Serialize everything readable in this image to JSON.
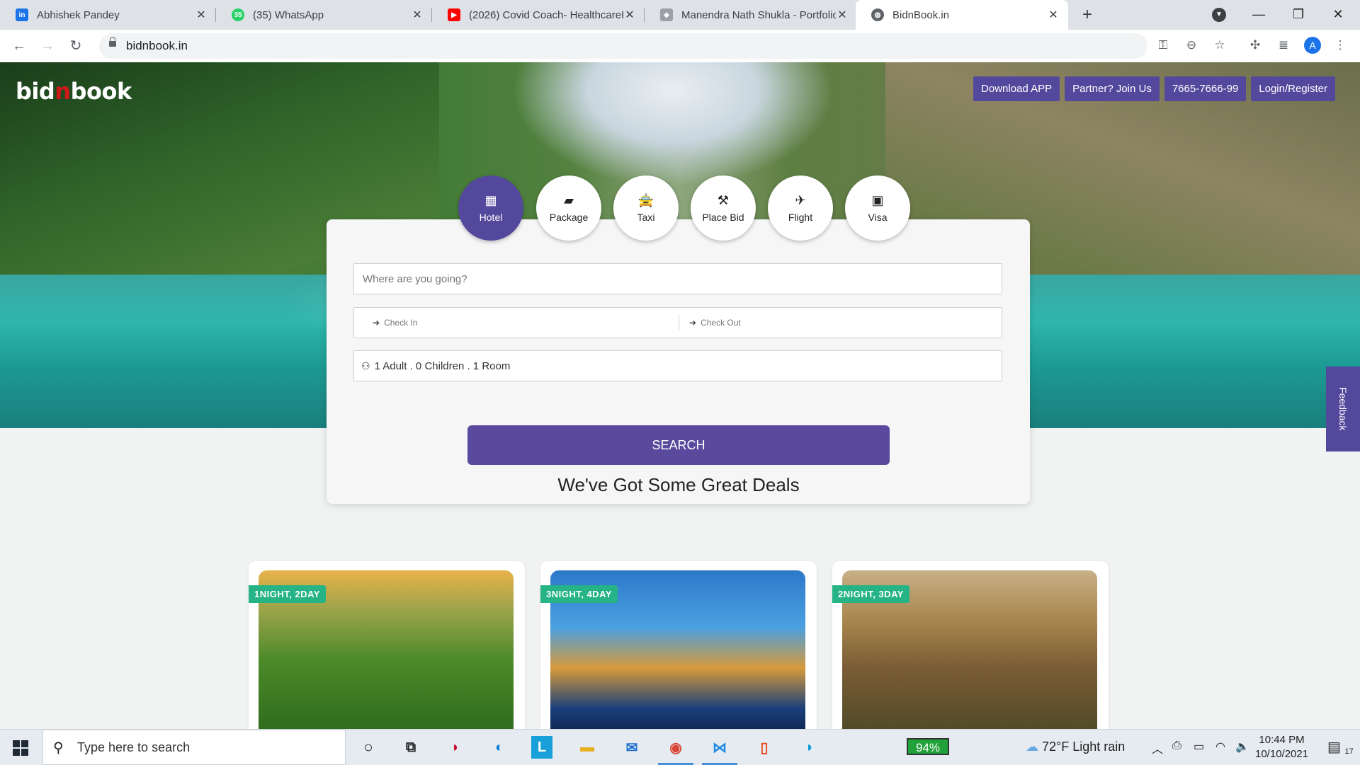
{
  "browser": {
    "tabs": [
      {
        "title": "Abhishek Pandey",
        "icon": "linkedin-style-icon",
        "color": "#1a73e8"
      },
      {
        "title": "(35) WhatsApp",
        "icon": "whatsapp-icon",
        "color": "#25d366",
        "badge": "35"
      },
      {
        "title": "(2026) Covid Coach- HealthcareP",
        "icon": "youtube-icon",
        "color": "#ff0000"
      },
      {
        "title": "Manendra Nath Shukla - Portfolic",
        "icon": "portfolio-icon",
        "color": "#5f6368"
      },
      {
        "title": "BidnBook.in",
        "icon": "globe-icon",
        "color": "#5f6368"
      }
    ],
    "url": "bidnbook.in",
    "profile_initial": "A"
  },
  "site": {
    "logo_prefix": "bid",
    "logo_n": "n",
    "logo_suffix": "book",
    "top_buttons": [
      "Download APP",
      "Partner? Join Us",
      "7665-7666-99",
      "Login/Register"
    ],
    "feedback_label": "Feedback",
    "services": [
      {
        "label": "Hotel",
        "icon": "hotel-icon",
        "glyph": "▦",
        "active": true
      },
      {
        "label": "Package",
        "icon": "package-icon",
        "glyph": "▰",
        "active": false
      },
      {
        "label": "Taxi",
        "icon": "taxi-icon",
        "glyph": "🚖",
        "active": false
      },
      {
        "label": "Place Bid",
        "icon": "gavel-icon",
        "glyph": "⚒",
        "active": false
      },
      {
        "label": "Flight",
        "icon": "flight-icon",
        "glyph": "✈",
        "active": false
      },
      {
        "label": "Visa",
        "icon": "passport-icon",
        "glyph": "▣",
        "active": false
      }
    ],
    "search": {
      "destination_placeholder": "Where are you going?",
      "checkin_label": "Check In",
      "checkout_label": "Check Out",
      "guests_value": "1 Adult . 0 Children . 1 Room",
      "button_label": "SEARCH"
    },
    "deals_heading": "We've Got Some Great Deals",
    "deals": [
      {
        "tag": "1NIGHT, 2DAY"
      },
      {
        "tag": "3NIGHT, 4DAY"
      },
      {
        "tag": "2NIGHT, 3DAY"
      }
    ],
    "accent_color": "#54489c",
    "tag_color": "#26b386"
  },
  "taskbar": {
    "search_placeholder": "Type here to search",
    "battery": "94%",
    "weather": "72°F  Light rain",
    "time": "10:44 PM",
    "date": "10/10/2021",
    "notification_count": "17"
  }
}
